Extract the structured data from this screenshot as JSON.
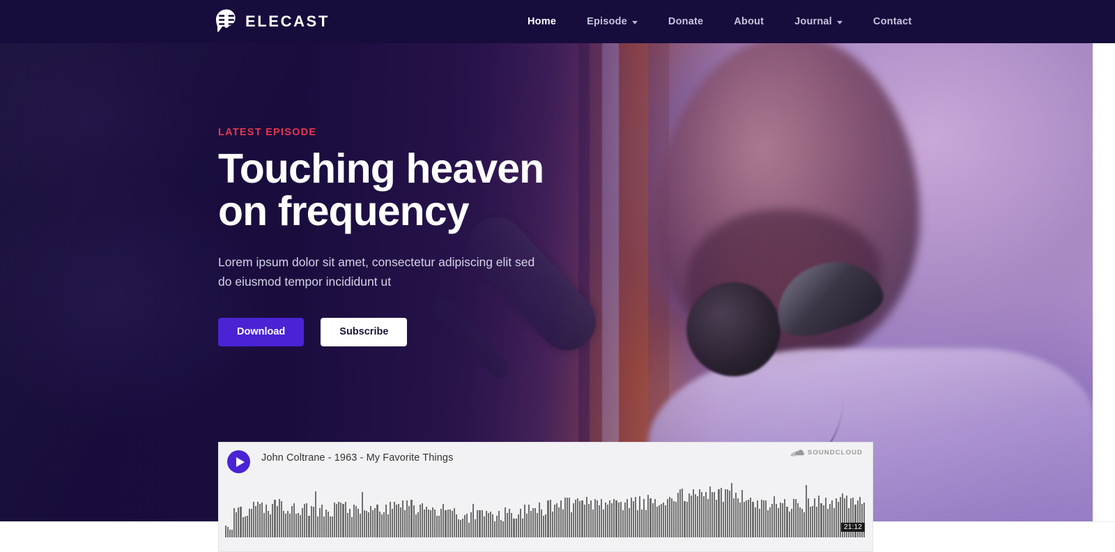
{
  "header": {
    "brand_name": "ELECAST",
    "brand_icon": "microphone-speech-bubble-icon",
    "nav": [
      {
        "label": "Home",
        "active": true,
        "has_dropdown": false
      },
      {
        "label": "Episode",
        "active": false,
        "has_dropdown": true
      },
      {
        "label": "Donate",
        "active": false,
        "has_dropdown": false
      },
      {
        "label": "About",
        "active": false,
        "has_dropdown": false
      },
      {
        "label": "Journal",
        "active": false,
        "has_dropdown": true
      },
      {
        "label": "Contact",
        "active": false,
        "has_dropdown": false
      }
    ]
  },
  "hero": {
    "eyebrow": "LATEST EPISODE",
    "title_line1": "Touching heaven",
    "title_line2": "on frequency",
    "description": "Lorem ipsum dolor sit amet, consectetur adipiscing elit sed do eiusmod tempor incididunt ut",
    "primary_button": "Download",
    "secondary_button": "Subscribe"
  },
  "player": {
    "play_icon": "play-icon",
    "track_title": "John Coltrane - 1963 - My Favorite Things",
    "provider": "SOUNDCLOUD",
    "provider_icon": "soundcloud-cloud-icon",
    "duration": "21:12"
  },
  "colors": {
    "accent_purple": "#4a23d4",
    "eyebrow_red": "#e5384f",
    "header_navy": "#170c3c",
    "player_bg": "#f2f2f4",
    "waveform_bar": "#6e6e6e"
  }
}
